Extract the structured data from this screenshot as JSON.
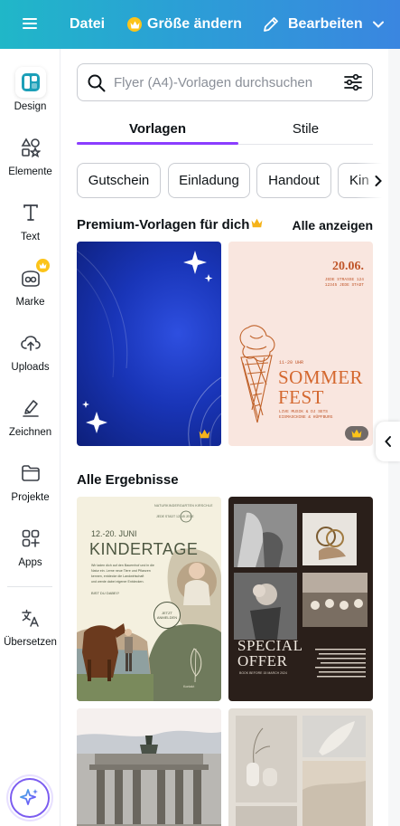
{
  "topbar": {
    "file_label": "Datei",
    "resize_label": "Größe ändern",
    "edit_label": "Bearbeiten"
  },
  "rail": {
    "items": [
      {
        "label": "Design",
        "icon": "design-icon"
      },
      {
        "label": "Elemente",
        "icon": "elements-icon"
      },
      {
        "label": "Text",
        "icon": "text-icon"
      },
      {
        "label": "Marke",
        "icon": "brand-icon"
      },
      {
        "label": "Uploads",
        "icon": "upload-cloud-icon"
      },
      {
        "label": "Zeichnen",
        "icon": "draw-icon"
      },
      {
        "label": "Projekte",
        "icon": "folder-icon"
      },
      {
        "label": "Apps",
        "icon": "apps-icon"
      },
      {
        "label": "Übersetzen",
        "icon": "translate-icon"
      }
    ]
  },
  "search": {
    "placeholder": "Flyer (A4)-Vorlagen durchsuchen"
  },
  "tabs": [
    {
      "label": "Vorlagen"
    },
    {
      "label": "Stile"
    }
  ],
  "chips": [
    {
      "label": "Gutschein"
    },
    {
      "label": "Einladung"
    },
    {
      "label": "Handout"
    },
    {
      "label": "Kin"
    }
  ],
  "premium": {
    "title": "Premium-Vorlagen für dich",
    "see_all": "Alle anzeigen"
  },
  "results": {
    "title": "Alle Ergebnisse"
  },
  "templates": {
    "summer": {
      "date": "20.06.",
      "addr1": "JEDE STRASSE 124",
      "addr2": "12345 JEDE STADT",
      "time": "11-20 UHR",
      "line1": "SOMMER",
      "line2": "FEST",
      "sub1": "LIVE MUSIK & DJ SETS",
      "sub2": "EISMASCHINE & HÜPFBURG"
    },
    "kids": {
      "header": "NATURKINDERGARTEN KIRSCHLE",
      "sub": "JEDE STADT  12345 JEDE",
      "dates": "12.-20. JUNI",
      "title": "KINDERTAGE",
      "p1": "Wir laden dich auf den Bauernhof und in die",
      "p2": "Natur ein. Lerne neue Tiere und Pflanzen",
      "p3": "kennen, entdecke die Landwirtschaft",
      "p4": "und werde dabei eigener Entdecken.",
      "cta": "BIST DU DABEI?",
      "btn1": "JETZT",
      "btn2": "ANMELDEN",
      "contact": "Kontakt"
    },
    "offer": {
      "line1": "SPECIAL",
      "line2": "OFFER",
      "sub": "BOOK BEFORE 15 MARCH 2024"
    }
  },
  "colors": {
    "accent": "#8b3dff",
    "crown": "#fcc419",
    "topbar_start": "#20b7c8",
    "topbar_end": "#3a86e0"
  }
}
